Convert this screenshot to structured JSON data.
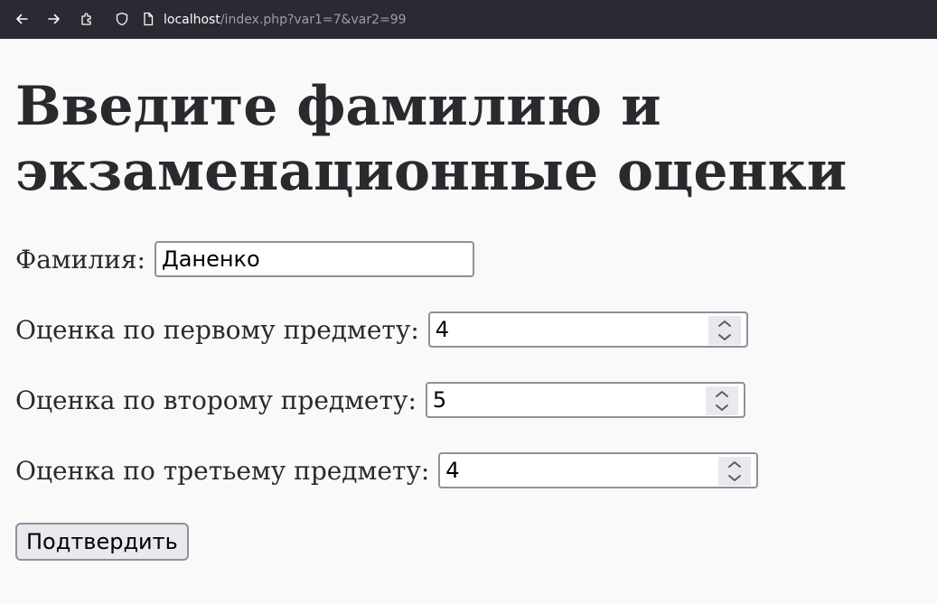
{
  "browser": {
    "url_host": "localhost",
    "url_path": "/index.php?var1=7&var2=99"
  },
  "page": {
    "heading": "Введите фамилию и экзаменационные оценки",
    "surname_label": "Фамилия:",
    "surname_value": "Даненко",
    "grade1_label": "Оценка по первому предмету:",
    "grade1_value": "4",
    "grade2_label": "Оценка по второму предмету:",
    "grade2_value": "5",
    "grade3_label": "Оценка по третьему предмету:",
    "grade3_value": "4",
    "submit_label": "Подтвердить"
  },
  "icons": {
    "back": "back-arrow-icon",
    "forward": "forward-arrow-icon",
    "extensions": "puzzle-icon",
    "tracking": "shield-icon",
    "page": "page-icon",
    "spinner_up": "chevron-up-icon",
    "spinner_down": "chevron-down-icon"
  }
}
